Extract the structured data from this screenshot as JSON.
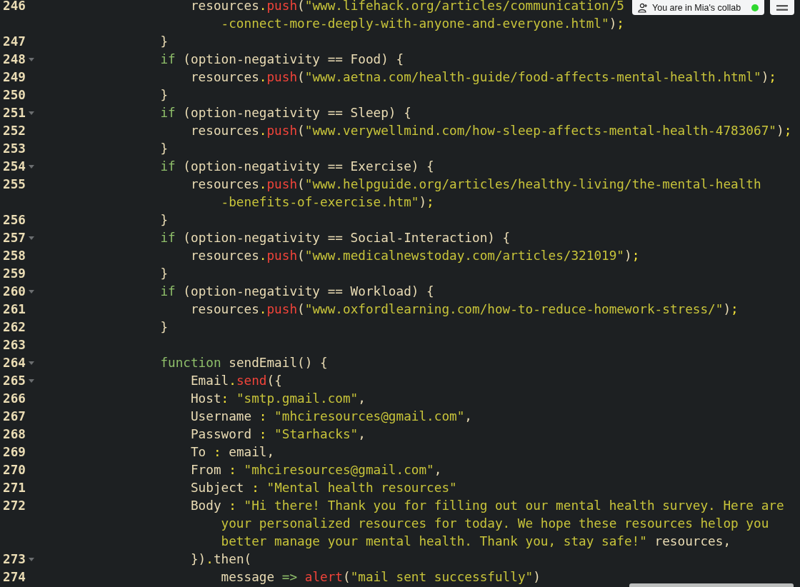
{
  "collab_badge": {
    "text": "You are in Mia's collab"
  },
  "lines": [
    {
      "children": [
        {
          "number": "246",
          "foldable": false,
          "rows": [
            {
              "tokens": [
                {
                  "kind": "id",
                  "text": "resources"
                },
                {
                  "kind": "op",
                  "text": "."
                },
                {
                  "kind": "fn",
                  "text": "push"
                },
                {
                  "kind": "id",
                  "text": "("
                },
                {
                  "kind": "str",
                  "text": "\"www.lifehack.org/articles/communication/5"
                }
              ]
            },
            {
              "tokens": [
                {
                  "kind": "str",
                  "text": "-connect-more-deeply-with-anyone-and-everyone.html\""
                },
                {
                  "kind": "id",
                  "text": ")"
                },
                {
                  "kind": "op",
                  "text": ";"
                }
              ]
            }
          ]
        }
      ]
    },
    {
      "number": "247",
      "foldable": false,
      "rows": [
        {
          "tokens": [
            {
              "kind": "id",
              "text": "}"
            }
          ]
        }
      ]
    },
    {
      "number": "248",
      "foldable": true,
      "rows": [
        {
          "tokens": [
            {
              "kind": "kw",
              "text": "if"
            },
            {
              "kind": "id",
              "text": " (option-negativity == Food) {"
            }
          ]
        }
      ],
      "children": [
        {
          "number": "249",
          "foldable": false,
          "rows": [
            {
              "tokens": [
                {
                  "kind": "id",
                  "text": "resources"
                },
                {
                  "kind": "op",
                  "text": "."
                },
                {
                  "kind": "fn",
                  "text": "push"
                },
                {
                  "kind": "id",
                  "text": "("
                },
                {
                  "kind": "str",
                  "text": "\"www.aetna.com/health-guide/food-affects-mental-health.html\""
                },
                {
                  "kind": "id",
                  "text": ")"
                },
                {
                  "kind": "op",
                  "text": ";"
                }
              ]
            }
          ]
        }
      ]
    },
    {
      "number": "250",
      "foldable": false,
      "rows": [
        {
          "tokens": [
            {
              "kind": "id",
              "text": "}"
            }
          ]
        }
      ]
    },
    {
      "number": "251",
      "foldable": true,
      "rows": [
        {
          "tokens": [
            {
              "kind": "kw",
              "text": "if"
            },
            {
              "kind": "id",
              "text": " (option-negativity == Sleep) {"
            }
          ]
        }
      ],
      "children": [
        {
          "number": "252",
          "foldable": false,
          "rows": [
            {
              "tokens": [
                {
                  "kind": "id",
                  "text": "resources"
                },
                {
                  "kind": "op",
                  "text": "."
                },
                {
                  "kind": "fn",
                  "text": "push"
                },
                {
                  "kind": "id",
                  "text": "("
                },
                {
                  "kind": "str",
                  "text": "\"www.verywellmind.com/how-sleep-affects-mental-health-4783067\""
                },
                {
                  "kind": "id",
                  "text": ")"
                },
                {
                  "kind": "op",
                  "text": ";"
                }
              ]
            }
          ]
        }
      ]
    },
    {
      "number": "253",
      "foldable": false,
      "rows": [
        {
          "tokens": [
            {
              "kind": "id",
              "text": "}"
            }
          ]
        }
      ]
    },
    {
      "number": "254",
      "foldable": true,
      "rows": [
        {
          "tokens": [
            {
              "kind": "kw",
              "text": "if"
            },
            {
              "kind": "id",
              "text": " (option-negativity == Exercise) {"
            }
          ]
        }
      ],
      "children": [
        {
          "number": "255",
          "foldable": false,
          "rows": [
            {
              "tokens": [
                {
                  "kind": "id",
                  "text": "resources"
                },
                {
                  "kind": "op",
                  "text": "."
                },
                {
                  "kind": "fn",
                  "text": "push"
                },
                {
                  "kind": "id",
                  "text": "("
                },
                {
                  "kind": "str",
                  "text": "\"www.helpguide.org/articles/healthy-living/the-mental-health"
                }
              ]
            },
            {
              "tokens": [
                {
                  "kind": "str",
                  "text": "-benefits-of-exercise.htm\""
                },
                {
                  "kind": "id",
                  "text": ")"
                },
                {
                  "kind": "op",
                  "text": ";"
                }
              ]
            }
          ]
        }
      ]
    },
    {
      "number": "256",
      "foldable": false,
      "rows": [
        {
          "tokens": [
            {
              "kind": "id",
              "text": "}"
            }
          ]
        }
      ]
    },
    {
      "number": "257",
      "foldable": true,
      "rows": [
        {
          "tokens": [
            {
              "kind": "kw",
              "text": "if"
            },
            {
              "kind": "id",
              "text": " (option-negativity == Social-Interaction) {"
            }
          ]
        }
      ],
      "children": [
        {
          "number": "258",
          "foldable": false,
          "rows": [
            {
              "tokens": [
                {
                  "kind": "id",
                  "text": "resources"
                },
                {
                  "kind": "op",
                  "text": "."
                },
                {
                  "kind": "fn",
                  "text": "push"
                },
                {
                  "kind": "id",
                  "text": "("
                },
                {
                  "kind": "str",
                  "text": "\"www.medicalnewstoday.com/articles/321019\""
                },
                {
                  "kind": "id",
                  "text": ")"
                },
                {
                  "kind": "op",
                  "text": ";"
                }
              ]
            }
          ]
        }
      ]
    },
    {
      "number": "259",
      "foldable": false,
      "rows": [
        {
          "tokens": [
            {
              "kind": "id",
              "text": "}"
            }
          ]
        }
      ]
    },
    {
      "number": "260",
      "foldable": true,
      "rows": [
        {
          "tokens": [
            {
              "kind": "kw",
              "text": "if"
            },
            {
              "kind": "id",
              "text": " (option-negativity == Workload) {"
            }
          ]
        }
      ],
      "children": [
        {
          "number": "261",
          "foldable": false,
          "rows": [
            {
              "tokens": [
                {
                  "kind": "id",
                  "text": "resources"
                },
                {
                  "kind": "op",
                  "text": "."
                },
                {
                  "kind": "fn",
                  "text": "push"
                },
                {
                  "kind": "id",
                  "text": "("
                },
                {
                  "kind": "str",
                  "text": "\"www.oxfordlearning.com/how-to-reduce-homework-stress/\""
                },
                {
                  "kind": "id",
                  "text": ")"
                },
                {
                  "kind": "op",
                  "text": ";"
                }
              ]
            }
          ]
        }
      ]
    },
    {
      "number": "262",
      "foldable": false,
      "rows": [
        {
          "tokens": [
            {
              "kind": "id",
              "text": "}"
            }
          ]
        }
      ]
    },
    {
      "number": "263",
      "foldable": false
    },
    {
      "number": "264",
      "foldable": true,
      "rows": [
        {
          "tokens": [
            {
              "kind": "kw",
              "text": "function"
            },
            {
              "kind": "id",
              "text": " sendEmail() {"
            }
          ]
        }
      ],
      "children": [
        {
          "number": "265",
          "foldable": true,
          "rows": [
            {
              "tokens": [
                {
                  "kind": "id",
                  "text": "Email"
                },
                {
                  "kind": "op",
                  "text": ".send"
                },
                {
                  "kind": "id",
                  "text": "({"
                }
              ]
            }
          ]
        },
        {
          "number": "266",
          "foldable": false,
          "rows": [
            {
              "tokens": [
                {
                  "kind": "id",
                  "text": "Host"
                },
                {
                  "kind": "op",
                  "text": ":"
                },
                {
                  "kind": "str",
                  "text": " \"smtp.gmail.com\""
                },
                {
                  "kind": "id",
                  "text": ","
                }
              ]
            }
          ]
        },
        {
          "number": "267",
          "foldable": false,
          "rows": [
            {
              "tokens": [
                {
                  "kind": "id",
                  "text": "Username "
                },
                {
                  "kind": "op",
                  "text": ":"
                },
                {
                  "kind": "str",
                  "text": " \"mhciresources@gmail.com\""
                },
                {
                  "kind": "id",
                  "text": ","
                }
              ]
            }
          ]
        },
        {
          "number": "268",
          "foldable": false,
          "rows": [
            {
              "tokens": [
                {
                  "kind": "id",
                  "text": "Password "
                },
                {
                  "kind": "op",
                  "text": ":"
                },
                {
                  "kind": "str",
                  "text": " \"Starhacks\""
                },
                {
                  "kind": "id",
                  "text": ","
                }
              ]
            }
          ]
        },
        {
          "number": "269",
          "foldable": false,
          "rows": [
            {
              "tokens": [
                {
                  "kind": "id",
                  "text": "To "
                },
                {
                  "kind": "op",
                  "text": ":"
                },
                {
                  "kind": "id",
                  "text": " email,"
                }
              ]
            }
          ]
        },
        {
          "number": "270",
          "foldable": false,
          "rows": [
            {
              "tokens": [
                {
                  "kind": "id",
                  "text": "From "
                },
                {
                  "kind": "op",
                  "text": ":"
                },
                {
                  "kind": "str",
                  "text": " \"mhciresources@gmail.com\""
                },
                {
                  "kind": "id",
                  "text": ","
                }
              ]
            }
          ]
        },
        {
          "number": "271",
          "foldable": false,
          "rows": [
            {
              "tokens": [
                {
                  "kind": "id",
                  "text": "Subject "
                },
                {
                  "kind": "op",
                  "text": ":"
                },
                {
                  "kind": "str",
                  "text": " \"Mental health resources\""
                }
              ]
            }
          ]
        },
        {
          "number": "272",
          "foldable": false,
          "rows": [
            {
              "tokens": [
                {
                  "kind": "id",
                  "text": "Body "
                },
                {
                  "kind": "op",
                  "text": ":"
                },
                {
                  "kind": "str",
                  "text": " \"Hi there! Thank you for filling out our mental health survey. Here are"
                }
              ]
            },
            {
              "tokens": [
                {
                  "kind": "str",
                  "text": "your personalized resources for today. We hope these resources helop you"
                }
              ]
            },
            {
              "tokens": [
                {
                  "kind": "str",
                  "text": "better manage your mental health. Thank you, stay safe!\""
                },
                {
                  "kind": "id",
                  "text": " resources,"
                }
              ]
            }
          ]
        },
        {
          "number": "273",
          "foldable": true,
          "rows": [
            {
              "tokens": [
                {
                  "kind": "id",
                  "text": "})"
                },
                {
                  "kind": "op",
                  "text": "."
                },
                {
                  "kind": "id",
                  "text": "then("
                }
              ]
            }
          ],
          "children": [
            {
              "number": "274",
              "foldable": false,
              "rows": [
                {
                  "tokens": [
                    {
                      "kind": "id",
                      "text": "message "
                    },
                    {
                      "kind": "kw",
                      "text": "=>"
                    },
                    {
                      "kind": "fn",
                      "text": " alert"
                    },
                    {
                      "kind": "id",
                      "text": "("
                    },
                    {
                      "kind": "str",
                      "text": "\"mail sent successfully\""
                    },
                    {
                      "kind": "id",
                      "text": ")"
                    }
                  ]
                }
              ]
            }
          ]
        }
      ]
    }
  ]
}
